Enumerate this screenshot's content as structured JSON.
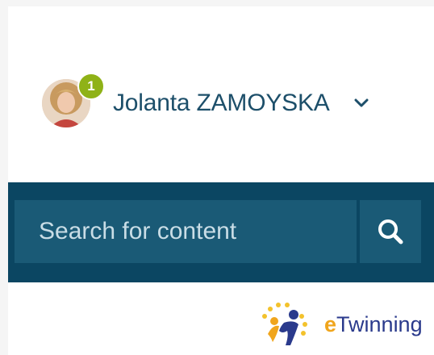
{
  "user": {
    "name": "Jolanta ZAMOYSKA",
    "notification_count": "1"
  },
  "search": {
    "placeholder": "Search for content"
  },
  "logo": {
    "prefix": "e",
    "rest": "Twinning"
  },
  "colors": {
    "header_text": "#1d4f6a",
    "badge": "#8fb217",
    "search_bar": "#0b4662",
    "search_field": "#1a5a76",
    "logo_blue": "#2a3a8c",
    "logo_yellow": "#f0a51c"
  },
  "icons": {
    "user_menu": "chevron-down-icon",
    "search": "search-icon"
  }
}
